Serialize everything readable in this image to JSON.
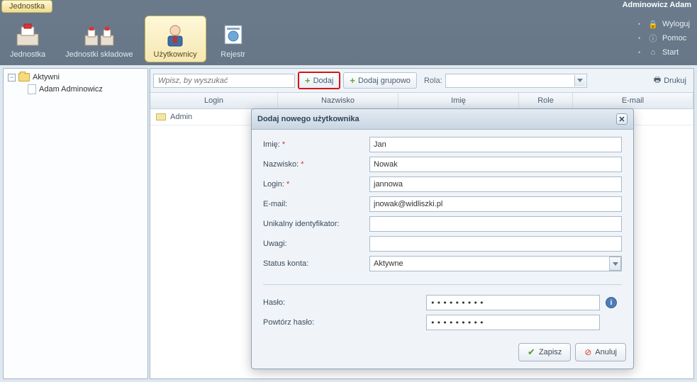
{
  "top_tab": "Jednostka",
  "user_name": "Adminowicz Adam",
  "ribbon": {
    "items": [
      {
        "label": "Jednostka"
      },
      {
        "label": "Jednostki składowe"
      },
      {
        "label": "Użytkownicy"
      },
      {
        "label": "Rejestr"
      }
    ]
  },
  "side_links": {
    "logout": "Wyloguj",
    "help": "Pomoc",
    "start": "Start"
  },
  "tree": {
    "root": "Aktywni",
    "child": "Adam Adminowicz"
  },
  "toolbar": {
    "search_placeholder": "Wpisz, by wyszukać",
    "add": "Dodaj",
    "add_group": "Dodaj grupowo",
    "role_label": "Rola:",
    "print": "Drukuj"
  },
  "grid": {
    "headers": {
      "login": "Login",
      "nazwisko": "Nazwisko",
      "imie": "Imię",
      "role": "Role",
      "email": "E-mail"
    },
    "rows": [
      {
        "login": "Admin"
      }
    ]
  },
  "dialog": {
    "title": "Dodaj nowego użytkownika",
    "labels": {
      "imie": "Imię:",
      "nazwisko": "Nazwisko:",
      "login": "Login:",
      "email": "E-mail:",
      "uid": "Unikalny identyfikator:",
      "uwagi": "Uwagi:",
      "status": "Status konta:",
      "haslo": "Hasło:",
      "haslo2": "Powtórz hasło:"
    },
    "values": {
      "imie": "Jan",
      "nazwisko": "Nowak",
      "login": "jannowa",
      "email": "jnowak@widliszki.pl",
      "uid": "",
      "uwagi": "",
      "status": "Aktywne",
      "haslo": "•••••••••",
      "haslo2": "•••••••••"
    },
    "required_marker": "*",
    "buttons": {
      "save": "Zapisz",
      "cancel": "Anuluj"
    }
  }
}
